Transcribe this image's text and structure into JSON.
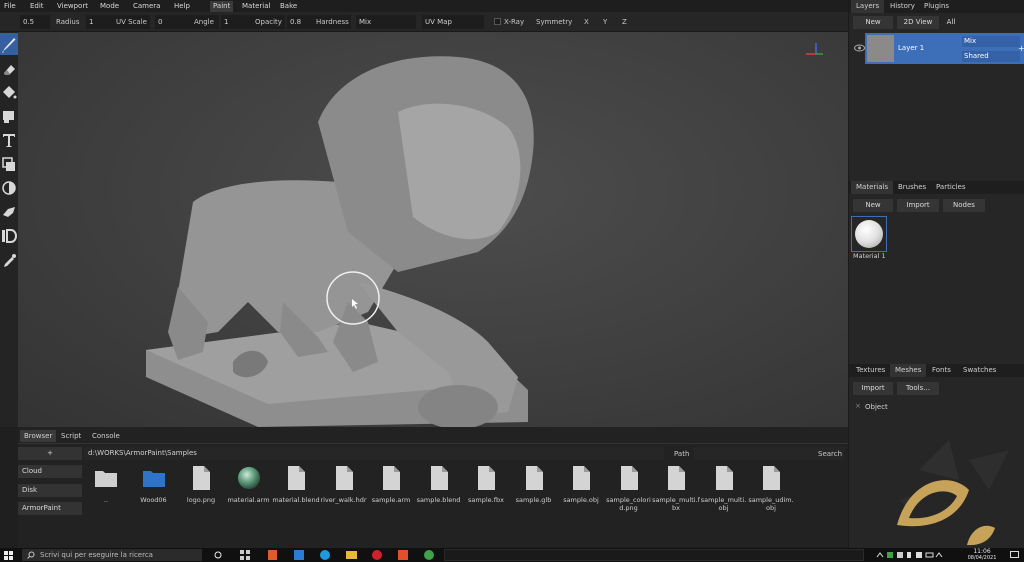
{
  "menu": {
    "file": "File",
    "edit": "Edit",
    "viewport": "Viewport",
    "mode": "Mode",
    "camera": "Camera",
    "help": "Help",
    "paint": "Paint",
    "material": "Material",
    "bake": "Bake"
  },
  "toolbar": {
    "brush_value": "0.5",
    "radius_label": "Radius",
    "radius_value": "1",
    "uvscale_label": "UV Scale",
    "uvscale_value": "0",
    "angle_label": "Angle",
    "angle_value": "1",
    "opacity_label": "Opacity",
    "opacity_value": "0.8",
    "hardness_label": "Hardness",
    "blend_value": "Mix",
    "uvmap_value": "UV Map",
    "xray_label": "X-Ray",
    "symmetry_label": "Symmetry",
    "x_label": "X",
    "y_label": "Y",
    "z_label": "Z"
  },
  "layers": {
    "tabs": [
      "Layers",
      "History",
      "Plugins"
    ],
    "new_label": "New",
    "view2d_label": "2D View",
    "all_label": "All",
    "layer_name": "Layer 1",
    "layer_blend": "Mix",
    "layer_shared": "Shared",
    "add_symbol": "+"
  },
  "materials": {
    "tabs": [
      "Materials",
      "Brushes",
      "Particles"
    ],
    "new_label": "New",
    "import_label": "Import",
    "nodes_label": "Nodes",
    "material_name": "Material 1"
  },
  "meshes": {
    "tabs": [
      "Textures",
      "Meshes",
      "Fonts",
      "Swatches"
    ],
    "import_label": "Import",
    "tools_label": "Tools...",
    "object_label": "Object"
  },
  "browser": {
    "tabs": [
      "Browser",
      "Script",
      "Console"
    ],
    "add_label": "+",
    "path": "d:\\WORKS\\ArmorPaint\\Samples",
    "path_label": "Path",
    "search_label": "Search",
    "locations": [
      "Cloud",
      "Disk",
      "ArmorPaint"
    ],
    "files": [
      {
        "name": "..",
        "type": "folder-grey"
      },
      {
        "name": "Wood06",
        "type": "folder-blue"
      },
      {
        "name": "logo.png",
        "type": "file"
      },
      {
        "name": "material.arm",
        "type": "sphere"
      },
      {
        "name": "material.blend",
        "type": "file"
      },
      {
        "name": "river_walk.hdr",
        "type": "file"
      },
      {
        "name": "sample.arm",
        "type": "file"
      },
      {
        "name": "sample.blend",
        "type": "file"
      },
      {
        "name": "sample.fbx",
        "type": "file"
      },
      {
        "name": "sample.glb",
        "type": "file"
      },
      {
        "name": "sample.obj",
        "type": "file"
      },
      {
        "name": "sample_colorid.png",
        "type": "file"
      },
      {
        "name": "sample_multi.fbx",
        "type": "file"
      },
      {
        "name": "sample_multi.obj",
        "type": "file"
      },
      {
        "name": "sample_udim.obj",
        "type": "file"
      }
    ]
  },
  "taskbar": {
    "search_placeholder": "Scrivi qui per eseguire la ricerca",
    "time": "11:06",
    "date": "08/04/2021"
  },
  "colors": {
    "accent": "#3d6fb8",
    "bg": "#262626",
    "viewport": "#3f3f3f"
  }
}
